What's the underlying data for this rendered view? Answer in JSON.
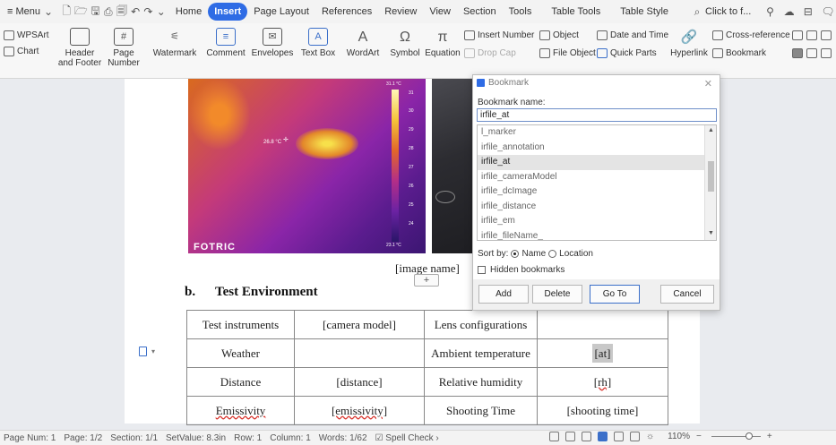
{
  "menubar": {
    "menu_label": "≡ Menu",
    "tabs": [
      "Home",
      "Insert",
      "Page Layout",
      "References",
      "Review",
      "View",
      "Section",
      "Tools",
      "Table Tools",
      "Table Style"
    ],
    "active_tab": "Insert",
    "search_placeholder": "Click to f..."
  },
  "ribbon": {
    "wpsart": "WPSArt",
    "chart": "Chart",
    "header_footer": "Header and Footer",
    "page_number": "Page Number",
    "watermark": "Watermark",
    "comment": "Comment",
    "envelopes": "Envelopes",
    "text_box": "Text Box",
    "wordart": "WordArt",
    "symbol": "Symbol",
    "equation": "Equation",
    "insert_number": "Insert Number",
    "drop_cap": "Drop Cap",
    "object": "Object",
    "file_object": "File Object",
    "date_time": "Date and Time",
    "quick_parts": "Quick Parts",
    "hyperlink": "Hyperlink",
    "cross_reference": "Cross-reference",
    "bookmark": "Bookmark"
  },
  "document": {
    "thermal_brand": "FOTRIC",
    "thermal_max": "31.1 °C",
    "thermal_min": "23.1 °C",
    "thermal_spot": "26.8 °C",
    "scale_ticks": [
      "31",
      "30",
      "29",
      "28",
      "27",
      "26",
      "25",
      "24"
    ],
    "image_name": "[image name]",
    "section_label": "b.",
    "section_title": "Test Environment",
    "table": [
      [
        "Test instruments",
        "[camera model]",
        "Lens configurations",
        ""
      ],
      [
        "Weather",
        "",
        "Ambient temperature",
        "[at]"
      ],
      [
        "Distance",
        "[distance]",
        "Relative humidity",
        "[rh]"
      ],
      [
        "Emissivity",
        "[emissivity]",
        "Shooting Time",
        "[shooting time]"
      ]
    ]
  },
  "dialog": {
    "title": "Bookmark",
    "name_label": "Bookmark name:",
    "name_value": "irfile_at",
    "items": [
      "l_marker",
      "irfile_annotation",
      "irfile_at",
      "irfile_cameraModel",
      "irfile_dcImage",
      "irfile_distance",
      "irfile_em",
      "irfile_fileName_"
    ],
    "selected_index": 2,
    "sort_label": "Sort by:",
    "sort_name": "Name",
    "sort_location": "Location",
    "hidden_label": "Hidden bookmarks",
    "add": "Add",
    "delete": "Delete",
    "goto": "Go To",
    "cancel": "Cancel"
  },
  "statusbar": {
    "page_num": "Page Num: 1",
    "page": "Page: 1/2",
    "section": "Section: 1/1",
    "setvalue": "SetValue: 8.3in",
    "row": "Row: 1",
    "column": "Column: 1",
    "words": "Words: 1/62",
    "spell": "Spell Check",
    "zoom": "110%"
  }
}
